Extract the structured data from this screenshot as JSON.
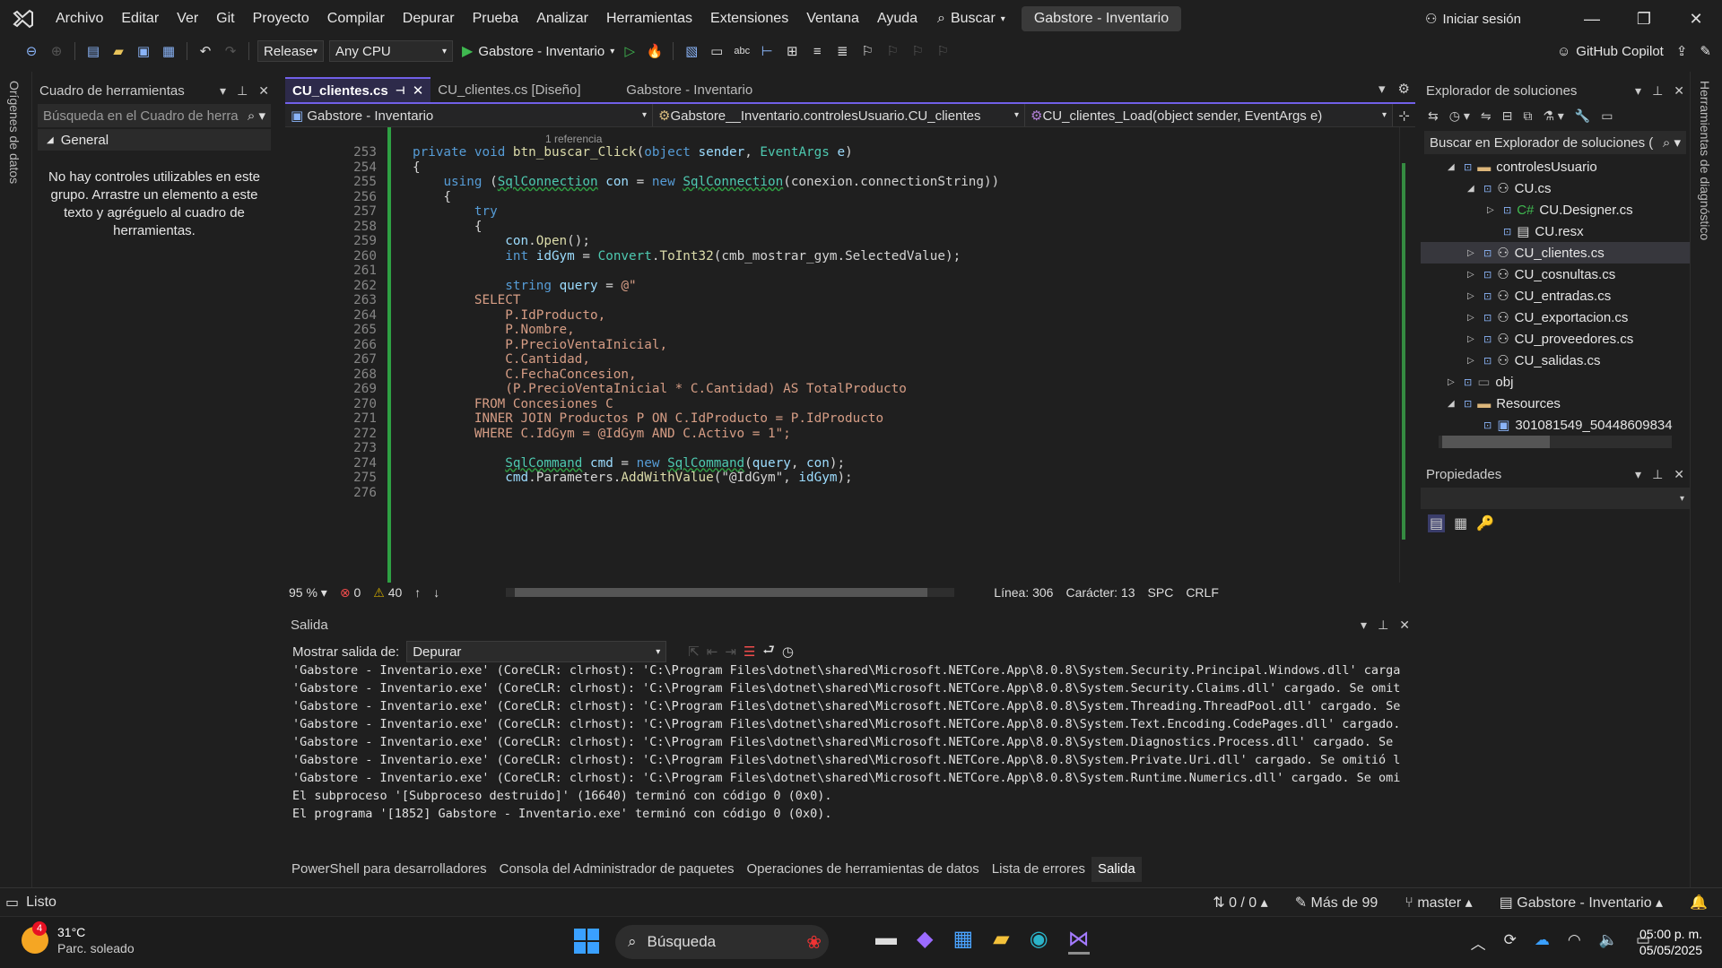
{
  "menubar": {
    "items": [
      "Archivo",
      "Editar",
      "Ver",
      "Git",
      "Proyecto",
      "Compilar",
      "Depurar",
      "Prueba",
      "Analizar",
      "Herramientas",
      "Extensiones",
      "Ventana",
      "Ayuda"
    ],
    "search": "Buscar",
    "title": "Gabstore - Inventario",
    "signin": "Iniciar sesión"
  },
  "toolbar": {
    "config": "Release",
    "platform": "Any CPU",
    "run_target": "Gabstore - Inventario",
    "copilot": "GitHub Copilot"
  },
  "leftstrip": {
    "label": "Orígenes de datos"
  },
  "rightstrip": {
    "label": "Herramientas de diagnóstico"
  },
  "toolbox": {
    "title": "Cuadro de herramientas",
    "search_placeholder": "Búsqueda en el Cuadro de herra",
    "group": "General",
    "empty_text": "No hay controles utilizables en este grupo. Arrastre un elemento a este texto y agréguelo al cuadro de herramientas."
  },
  "editor": {
    "tabs": [
      "CU_clientes.cs",
      "CU_clientes.cs [Diseño]",
      "Gabstore - Inventario"
    ],
    "nav": [
      "Gabstore - Inventario",
      "Gabstore__Inventario.controlesUsuario.CU_clientes",
      "CU_clientes_Load(object sender, EventArgs e)"
    ],
    "ref_hint": "1 referencia",
    "lines": [
      {
        "n": "253",
        "code": "private void btn_buscar_Click(object sender, EventArgs e)"
      },
      {
        "n": "254",
        "code": "{"
      },
      {
        "n": "255",
        "code": "    using (SqlConnection con = new SqlConnection(conexion.connectionString))"
      },
      {
        "n": "256",
        "code": "    {"
      },
      {
        "n": "257",
        "code": "        try"
      },
      {
        "n": "258",
        "code": "        {"
      },
      {
        "n": "259",
        "code": "            con.Open();"
      },
      {
        "n": "260",
        "code": "            int idGym = Convert.ToInt32(cmb_mostrar_gym.SelectedValue);"
      },
      {
        "n": "261",
        "code": ""
      },
      {
        "n": "262",
        "code": "            string query = @\""
      },
      {
        "n": "263",
        "code": "        SELECT"
      },
      {
        "n": "264",
        "code": "            P.IdProducto,"
      },
      {
        "n": "265",
        "code": "            P.Nombre,"
      },
      {
        "n": "266",
        "code": "            P.PrecioVentaInicial,"
      },
      {
        "n": "267",
        "code": "            C.Cantidad,"
      },
      {
        "n": "268",
        "code": "            C.FechaConcesion,"
      },
      {
        "n": "269",
        "code": "            (P.PrecioVentaInicial * C.Cantidad) AS TotalProducto"
      },
      {
        "n": "270",
        "code": "        FROM Concesiones C"
      },
      {
        "n": "271",
        "code": "        INNER JOIN Productos P ON C.IdProducto = P.IdProducto"
      },
      {
        "n": "272",
        "code": "        WHERE C.IdGym = @IdGym AND C.Activo = 1\";"
      },
      {
        "n": "273",
        "code": ""
      },
      {
        "n": "274",
        "code": "            SqlCommand cmd = new SqlCommand(query, con);"
      },
      {
        "n": "275",
        "code": "            cmd.Parameters.AddWithValue(\"@IdGym\", idGym);"
      },
      {
        "n": "276",
        "code": ""
      }
    ],
    "status": {
      "zoom": "95 %",
      "errors": "0",
      "warnings": "40",
      "line": "Línea: 306",
      "char": "Carácter: 13",
      "spc": "SPC",
      "eol": "CRLF"
    }
  },
  "output": {
    "title": "Salida",
    "show_label": "Mostrar salida de:",
    "source": "Depurar",
    "lines": [
      "'Gabstore - Inventario.exe' (CoreCLR: clrhost): 'C:\\Program Files\\dotnet\\shared\\Microsoft.NETCore.App\\8.0.8\\System.Security.Principal.Windows.dll' carga",
      "'Gabstore - Inventario.exe' (CoreCLR: clrhost): 'C:\\Program Files\\dotnet\\shared\\Microsoft.NETCore.App\\8.0.8\\System.Security.Claims.dll' cargado. Se omit",
      "'Gabstore - Inventario.exe' (CoreCLR: clrhost): 'C:\\Program Files\\dotnet\\shared\\Microsoft.NETCore.App\\8.0.8\\System.Threading.ThreadPool.dll' cargado. Se",
      "'Gabstore - Inventario.exe' (CoreCLR: clrhost): 'C:\\Program Files\\dotnet\\shared\\Microsoft.NETCore.App\\8.0.8\\System.Text.Encoding.CodePages.dll' cargado.",
      "'Gabstore - Inventario.exe' (CoreCLR: clrhost): 'C:\\Program Files\\dotnet\\shared\\Microsoft.NETCore.App\\8.0.8\\System.Diagnostics.Process.dll' cargado. Se",
      "'Gabstore - Inventario.exe' (CoreCLR: clrhost): 'C:\\Program Files\\dotnet\\shared\\Microsoft.NETCore.App\\8.0.8\\System.Private.Uri.dll' cargado. Se omitió l",
      "'Gabstore - Inventario.exe' (CoreCLR: clrhost): 'C:\\Program Files\\dotnet\\shared\\Microsoft.NETCore.App\\8.0.8\\System.Runtime.Numerics.dll' cargado. Se omi",
      "El subproceso '[Subproceso destruido]' (16640) terminó con código 0 (0x0).",
      "El programa '[1852] Gabstore - Inventario.exe' terminó con código 0 (0x0)."
    ]
  },
  "bottom_tabs": [
    "PowerShell para desarrolladores",
    "Consola del Administrador de paquetes",
    "Operaciones de herramientas de datos",
    "Lista de errores",
    "Salida"
  ],
  "solution_explorer": {
    "title": "Explorador de soluciones",
    "search_placeholder": "Buscar en Explorador de soluciones (",
    "items": [
      {
        "label": "controlesUsuario",
        "indent": 1,
        "kind": "folder",
        "expander": "◢"
      },
      {
        "label": "CU.cs",
        "indent": 2,
        "kind": "form",
        "expander": "◢"
      },
      {
        "label": "CU.Designer.cs",
        "indent": 3,
        "kind": "cs",
        "expander": "▷"
      },
      {
        "label": "CU.resx",
        "indent": 3,
        "kind": "resx",
        "expander": ""
      },
      {
        "label": "CU_clientes.cs",
        "indent": 2,
        "kind": "form",
        "expander": "▷",
        "selected": true
      },
      {
        "label": "CU_cosnultas.cs",
        "indent": 2,
        "kind": "form",
        "expander": "▷"
      },
      {
        "label": "CU_entradas.cs",
        "indent": 2,
        "kind": "form",
        "expander": "▷"
      },
      {
        "label": "CU_exportacion.cs",
        "indent": 2,
        "kind": "form",
        "expander": "▷"
      },
      {
        "label": "CU_proveedores.cs",
        "indent": 2,
        "kind": "form",
        "expander": "▷"
      },
      {
        "label": "CU_salidas.cs",
        "indent": 2,
        "kind": "form",
        "expander": "▷"
      },
      {
        "label": "obj",
        "indent": 1,
        "kind": "folder-gray",
        "expander": "▷"
      },
      {
        "label": "Resources",
        "indent": 1,
        "kind": "folder",
        "expander": "◢"
      },
      {
        "label": "301081549_50448609834",
        "indent": 2,
        "kind": "image",
        "expander": ""
      }
    ]
  },
  "properties": {
    "title": "Propiedades"
  },
  "statusbar": {
    "ready": "Listo",
    "changes": "0 / 0",
    "more": "Más de 99",
    "branch": "master",
    "repo": "Gabstore - Inventario"
  },
  "taskbar": {
    "temp": "31°C",
    "weather": "Parc. soleado",
    "badge": "4",
    "search": "Búsqueda",
    "time": "05:00 p. m.",
    "date": "05/05/2025"
  },
  "colors": {
    "accent": "#7160e8",
    "green_change": "#3fb950",
    "error": "#f14c4c",
    "warning": "#cca700"
  }
}
